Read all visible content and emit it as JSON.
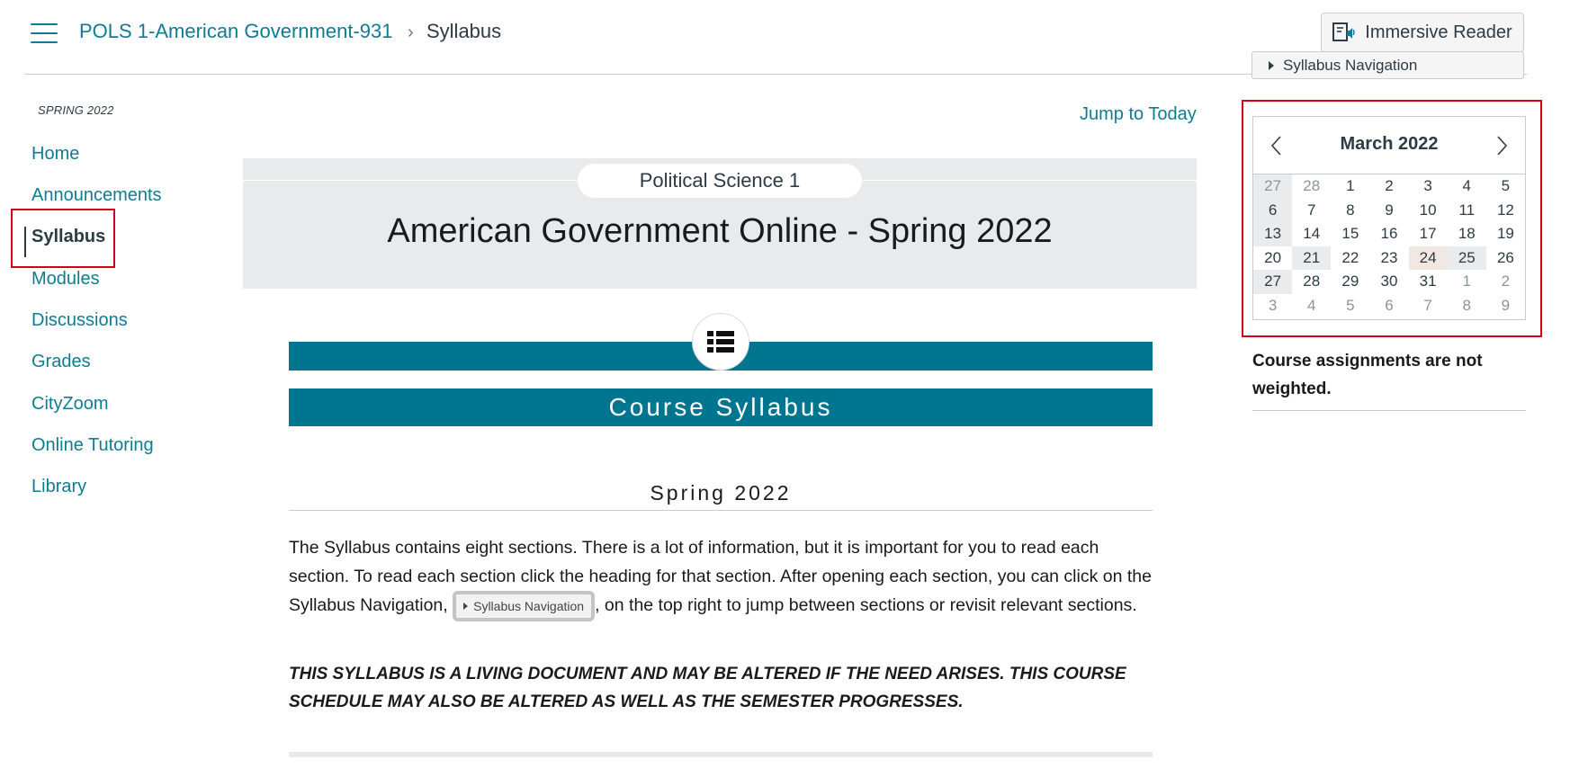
{
  "header": {
    "course_link": "POLS 1-American Government-931",
    "separator": "›",
    "current_page": "Syllabus",
    "immersive_reader_label": "Immersive Reader",
    "syllabus_nav_label": "Syllabus Navigation"
  },
  "sidebar": {
    "term": "SPRING 2022",
    "items": [
      {
        "label": "Home"
      },
      {
        "label": "Announcements"
      },
      {
        "label": "Syllabus",
        "active": true
      },
      {
        "label": "Modules"
      },
      {
        "label": "Discussions"
      },
      {
        "label": "Grades"
      },
      {
        "label": "CityZoom"
      },
      {
        "label": "Online Tutoring"
      },
      {
        "label": "Library"
      }
    ]
  },
  "main": {
    "jump_to_today": "Jump to Today",
    "banner_pill": "Political Science 1",
    "banner_title": "American Government Online - Spring 2022",
    "section_icon": "list-icon",
    "course_syllabus_heading": "Course Syllabus",
    "term_heading": "Spring 2022",
    "intro_before": "The Syllabus contains eight sections. There is a lot of information, but it is important for you to read each section. To read each section click the heading for that section.  After opening each section, you can click on the Syllabus Navigation, ",
    "intro_inline_button": "Syllabus Navigation",
    "intro_after": ", on the top right to jump between sections or revisit relevant sections.",
    "warning": "THIS SYLLABUS IS A LIVING DOCUMENT AND MAY BE ALTERED IF THE NEED ARISES.  THIS COURSE SCHEDULE MAY ALSO BE ALTERED AS WELL AS THE SEMESTER PROGRESSES."
  },
  "calendar": {
    "title": "March 2022",
    "prev_icon": "chevron-left-icon",
    "next_icon": "chevron-right-icon",
    "days": [
      {
        "d": "27",
        "out": true,
        "past": true
      },
      {
        "d": "28",
        "out": true
      },
      {
        "d": "1"
      },
      {
        "d": "2"
      },
      {
        "d": "3"
      },
      {
        "d": "4"
      },
      {
        "d": "5"
      },
      {
        "d": "6",
        "past": true
      },
      {
        "d": "7"
      },
      {
        "d": "8"
      },
      {
        "d": "9"
      },
      {
        "d": "10"
      },
      {
        "d": "11"
      },
      {
        "d": "12"
      },
      {
        "d": "13",
        "past": true
      },
      {
        "d": "14"
      },
      {
        "d": "15"
      },
      {
        "d": "16"
      },
      {
        "d": "17"
      },
      {
        "d": "18"
      },
      {
        "d": "19"
      },
      {
        "d": "20"
      },
      {
        "d": "21",
        "past": true
      },
      {
        "d": "22"
      },
      {
        "d": "23"
      },
      {
        "d": "24",
        "event": true
      },
      {
        "d": "25",
        "past": true
      },
      {
        "d": "26"
      },
      {
        "d": "27",
        "past": true
      },
      {
        "d": "28"
      },
      {
        "d": "29"
      },
      {
        "d": "30"
      },
      {
        "d": "31"
      },
      {
        "d": "1",
        "out": true
      },
      {
        "d": "2",
        "out": true
      },
      {
        "d": "3",
        "out": true
      },
      {
        "d": "4",
        "out": true
      },
      {
        "d": "5",
        "out": true
      },
      {
        "d": "6",
        "out": true
      },
      {
        "d": "7",
        "out": true
      },
      {
        "d": "8",
        "out": true
      },
      {
        "d": "9",
        "out": true
      }
    ]
  },
  "sidebar_right": {
    "weight_note": "Course assignments are not weighted."
  },
  "colors": {
    "link": "#0e7c92",
    "accent_teal": "#00758f",
    "highlight_red": "#d0021b"
  }
}
